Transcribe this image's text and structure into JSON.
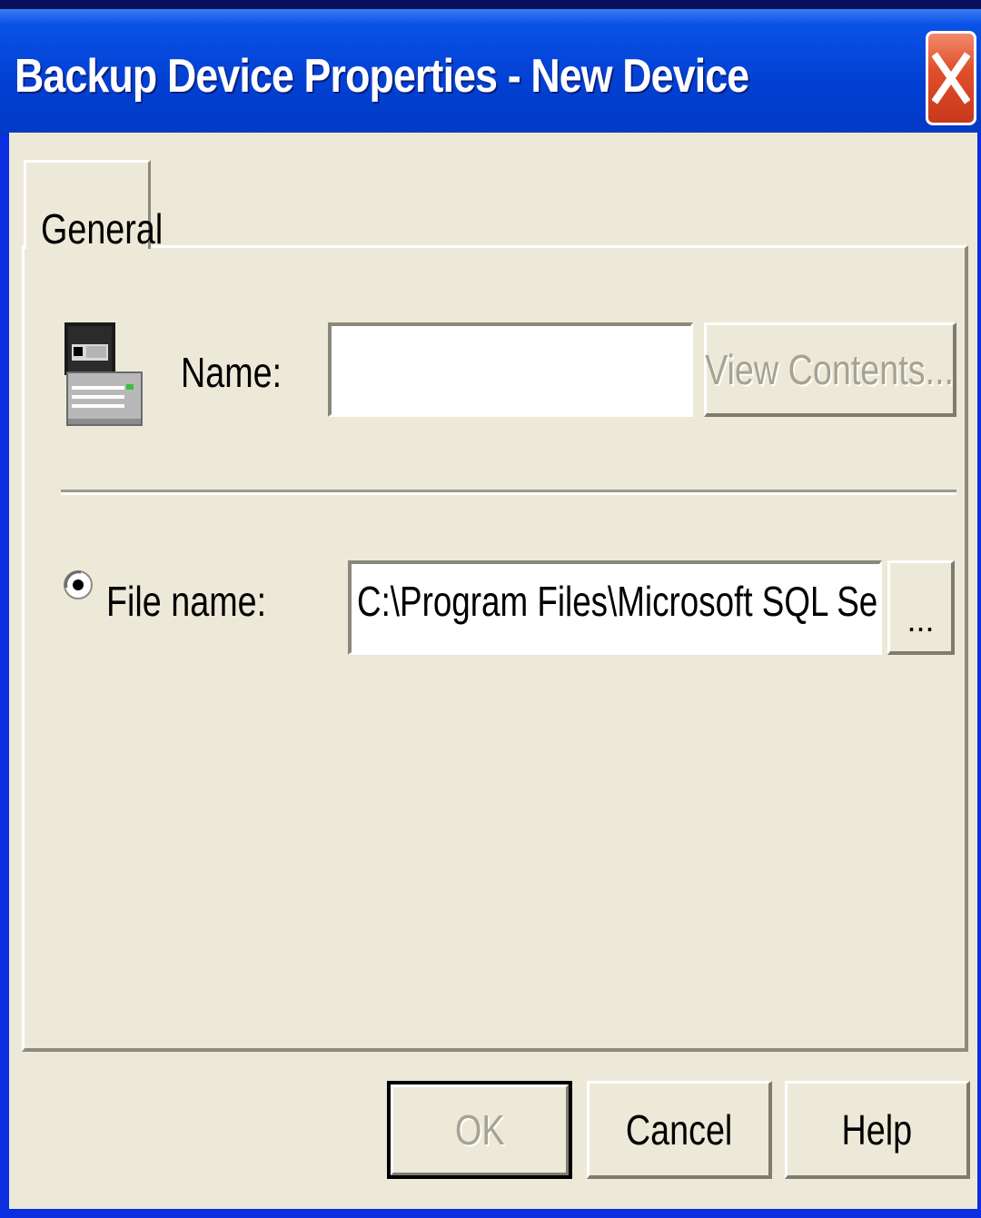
{
  "window": {
    "title": "Backup Device Properties - New Device",
    "close_icon": "close-icon"
  },
  "tabs": [
    {
      "label": "General",
      "selected": true
    }
  ],
  "general": {
    "device_icon": "backup-device-icon",
    "name_label": "Name:",
    "name_value": "",
    "view_contents_label": "View Contents...",
    "view_contents_enabled": false,
    "file_name_label": "File name:",
    "file_name_selected": true,
    "file_name_value": "C:\\Program Files\\Microsoft SQL Server\\MSS",
    "browse_label": "..."
  },
  "footer": {
    "ok_label": "OK",
    "ok_enabled": false,
    "cancel_label": "Cancel",
    "help_label": "Help"
  },
  "colors": {
    "titlebar": "#0241d4",
    "dialog_face": "#ece9d8",
    "close_button": "#e0502c",
    "disabled_text": "#a6a393"
  }
}
